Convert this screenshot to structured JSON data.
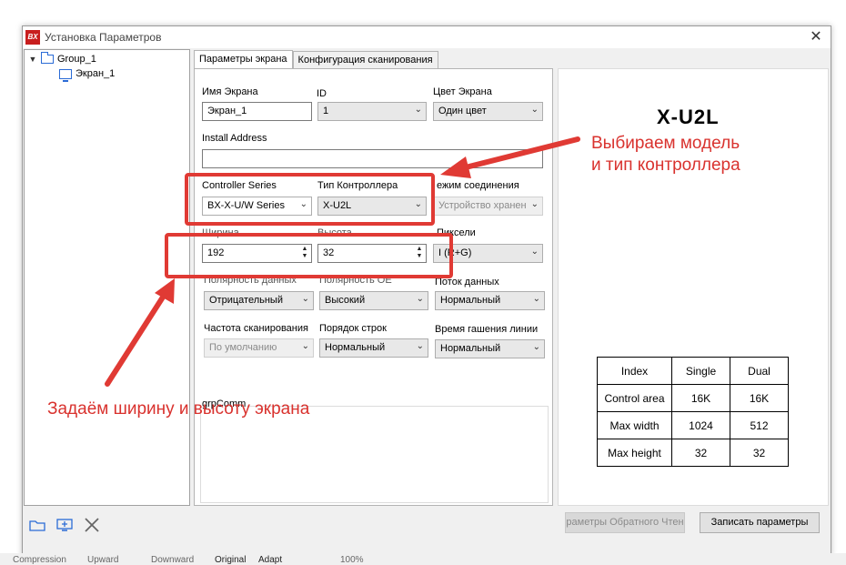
{
  "window": {
    "title": "Установка Параметров",
    "logo": "BX"
  },
  "tree": {
    "group_label": "Group_1",
    "screen_label": "Экран_1",
    "tools": [
      "folder-icon",
      "add-screen-icon",
      "delete-icon"
    ]
  },
  "tabs": [
    "Параметры экрана",
    "Конфигурация сканирования"
  ],
  "form": {
    "screen_name": {
      "label": "Имя Экрана",
      "value": "Экран_1"
    },
    "id": {
      "label": "ID",
      "value": "1"
    },
    "color": {
      "label": "Цвет Экрана",
      "value": "Один цвет"
    },
    "install_address": {
      "label": "Install Address",
      "value": ""
    },
    "controller_series": {
      "label": "Controller Series",
      "value": "BX-X-U/W Series"
    },
    "controller_type": {
      "label": "Тип Контроллера",
      "value": "X-U2L"
    },
    "connection_mode": {
      "label": "ежим соединения",
      "value": "Устройство хранен"
    },
    "width": {
      "label": "Ширина",
      "value": "192"
    },
    "height": {
      "label": "Высота",
      "value": "32"
    },
    "pixels": {
      "label": "Пиксели",
      "value": "I  (R+G)"
    },
    "data_polarity": {
      "label": "Полярность данных",
      "value": "Отрицательный"
    },
    "oe_polarity": {
      "label": "Полярность OE",
      "value": "Высокий"
    },
    "data_flow": {
      "label": "Поток данных",
      "value": "Нормальный"
    },
    "scan_freq": {
      "label": "Частота сканирования",
      "value": "По умолчанию"
    },
    "row_order": {
      "label": "Порядок строк",
      "value": "Нормальный"
    },
    "line_blank": {
      "label": "Время гашения линии",
      "value": "Нормальный"
    },
    "group_comm": "grpComm"
  },
  "preview": {
    "model": "X-U2L",
    "table_headers": [
      "Index",
      "Single",
      "Dual"
    ],
    "table_rows": [
      [
        "Control area",
        "16K",
        "16K"
      ],
      [
        "Max width",
        "1024",
        "512"
      ],
      [
        "Max height",
        "32",
        "32"
      ]
    ]
  },
  "buttons": {
    "readback": "раметры Обратного Чтен",
    "write": "Записать параметры"
  },
  "annotations": {
    "top": "Выбираем модель\nи тип контроллера",
    "bottom": "Задаём ширину и высоту экрана",
    "color": "#d9322e"
  },
  "statusbar": [
    "Compression",
    "Upward",
    "Downward",
    "Original",
    "Adapt",
    "100%"
  ]
}
